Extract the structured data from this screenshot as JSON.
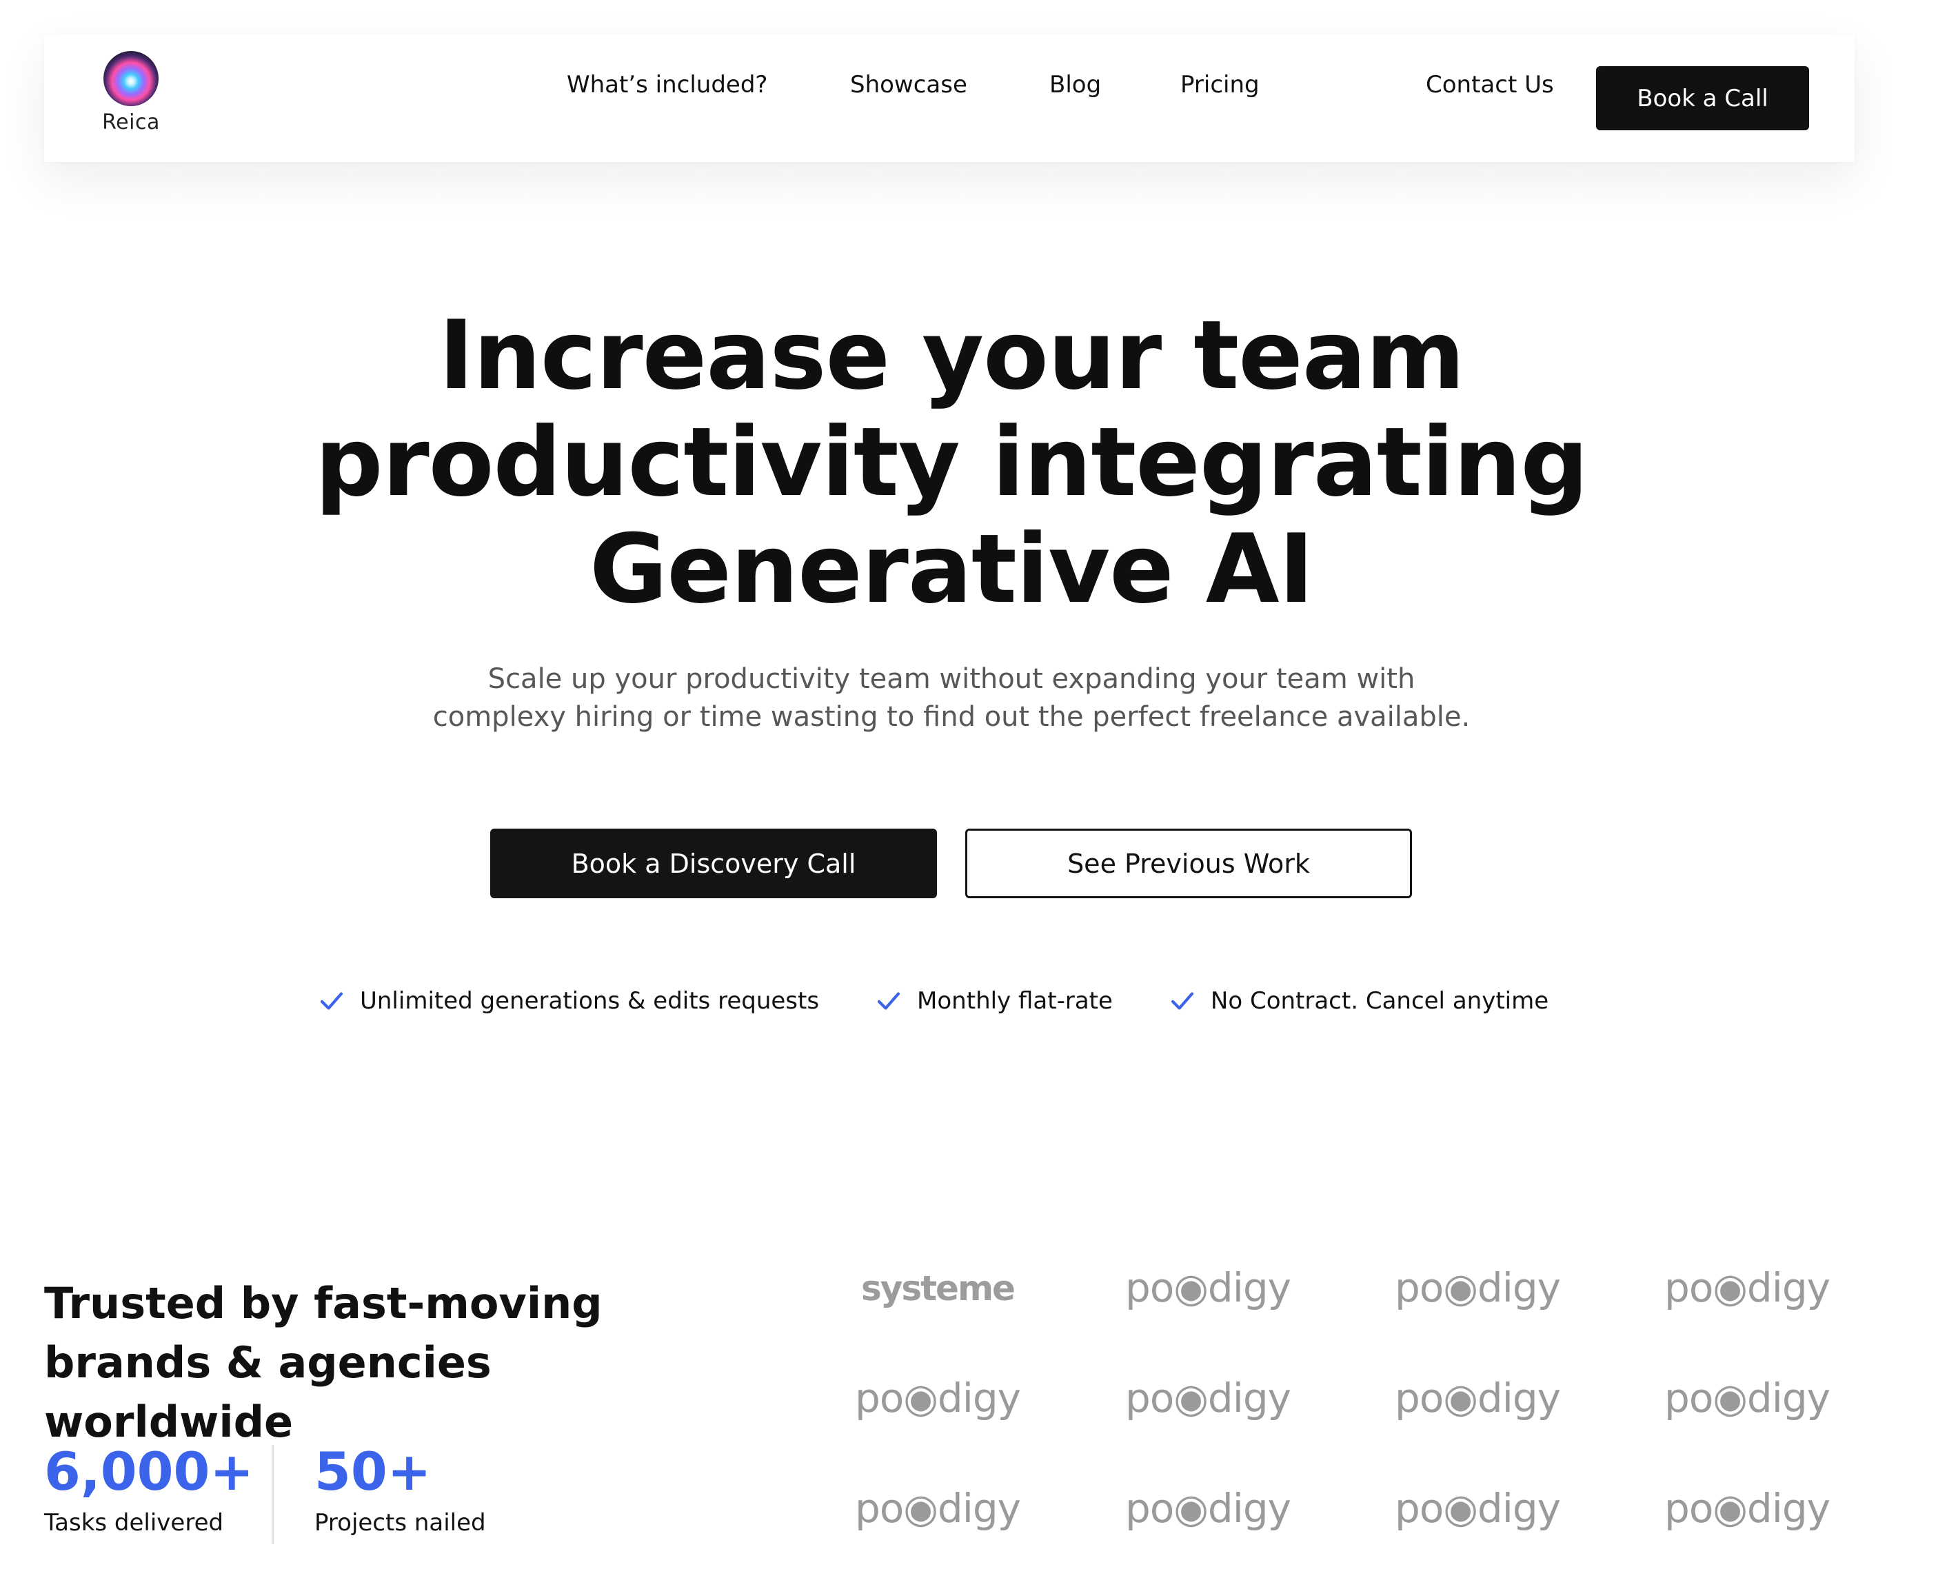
{
  "brand": {
    "name": "Reica"
  },
  "nav": {
    "links": [
      "What’s included?",
      "Showcase",
      "Blog",
      "Pricing",
      "Contact Us"
    ],
    "cta": "Book a Call"
  },
  "hero": {
    "title_lines": [
      "Increase your team",
      "productivity integrating",
      "Generative AI"
    ],
    "subtitle": "Scale up your productivity team without expanding your team with complexy hiring or time wasting to find out the perfect freelance available.",
    "primary_button": "Book a Discovery Call",
    "secondary_button": "See Previous Work",
    "features": [
      "Unlimited generations & edits requests",
      "Monthly flat-rate",
      "No Contract. Cancel anytime"
    ]
  },
  "trusted": {
    "heading_lines": [
      "Trusted by fast-moving",
      "brands & agencies worldwide"
    ],
    "stats": [
      {
        "value": "6,000+",
        "label": "Tasks delivered"
      },
      {
        "value": "50+",
        "label": "Projects nailed"
      }
    ],
    "logos": [
      "systeme",
      "po◉digy",
      "po◉digy",
      "po◉digy",
      "po◉digy",
      "po◉digy",
      "po◉digy",
      "po◉digy",
      "po◉digy",
      "po◉digy",
      "po◉digy",
      "po◉digy"
    ]
  },
  "colors": {
    "accent": "#3b64ea",
    "dark": "#141414",
    "muted": "#575757",
    "logo_gray": "#9a9a9a"
  }
}
